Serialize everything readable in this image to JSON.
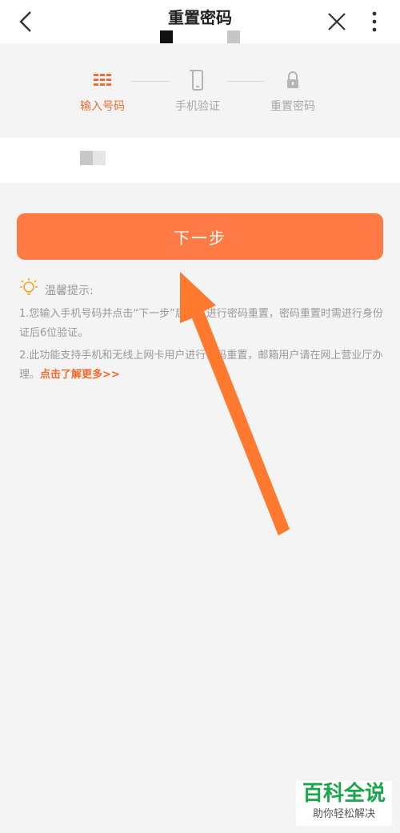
{
  "header": {
    "title": "重置密码",
    "back_icon": "chevron-left-icon",
    "close_icon": "close-icon",
    "more_icon": "more-vertical-icon"
  },
  "steps": [
    {
      "label": "输入号码",
      "icon": "keypad-icon",
      "state": "active"
    },
    {
      "label": "手机验证",
      "icon": "phone-icon",
      "state": "inactive"
    },
    {
      "label": "重置密码",
      "icon": "lock-icon",
      "state": "inactive"
    }
  ],
  "phone_input": {
    "value": "",
    "placeholder": ""
  },
  "next_button": {
    "label": "下一步"
  },
  "tips": {
    "title": "温馨提示:",
    "items": [
      "1.您输入手机号码并点击“下一步”后，可进行密码重置，密码重置时需进行身份证后6位验证。",
      "2.此功能支持手机和无线上网卡用户进行密码重置，邮箱用户请在网上营业厅办理。"
    ],
    "more_link": "点击了解更多>>"
  },
  "watermark": {
    "main": "百科全说",
    "sub": "助你轻松解决"
  },
  "colors": {
    "accent": "#f26b2f",
    "button": "#ff7a45",
    "arrow": "#ff7a2e",
    "watermark": "#1aa64a"
  }
}
